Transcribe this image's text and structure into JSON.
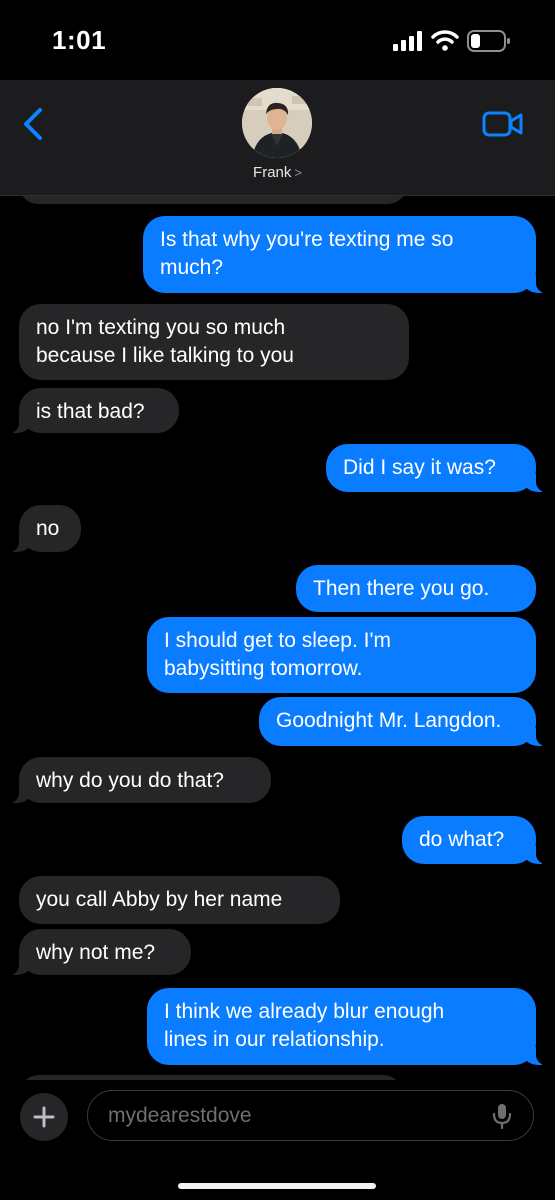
{
  "status_bar": {
    "time": "1:01"
  },
  "header": {
    "contact_name": "Frank",
    "contact_chevron": ">"
  },
  "messages": [
    {
      "direction": "outgoing",
      "text": "Is that why you're texting me so\nmuch?"
    },
    {
      "direction": "incoming",
      "text": "no I'm texting you so much\nbecause I like talking to you"
    },
    {
      "direction": "incoming",
      "text": "is that bad?"
    },
    {
      "direction": "outgoing",
      "text": "Did I say it was?"
    },
    {
      "direction": "incoming",
      "text": "no"
    },
    {
      "direction": "outgoing",
      "text": "Then there you go."
    },
    {
      "direction": "outgoing",
      "text": "I should get to sleep. I'm\nbabysitting tomorrow."
    },
    {
      "direction": "outgoing",
      "text": "Goodnight Mr. Langdon."
    },
    {
      "direction": "incoming",
      "text": "why do you do that?"
    },
    {
      "direction": "outgoing",
      "text": "do what?"
    },
    {
      "direction": "incoming",
      "text": "you call Abby by her name"
    },
    {
      "direction": "incoming",
      "text": "why not me?"
    },
    {
      "direction": "outgoing",
      "text": "I think we already blur enough\nlines in our relationship."
    }
  ],
  "composer": {
    "placeholder": "mydearestdove",
    "plus_label": "+"
  },
  "colors": {
    "outgoing_bubble": "#0a7cff",
    "incoming_bubble": "#262628",
    "accent": "#0a84ff"
  }
}
